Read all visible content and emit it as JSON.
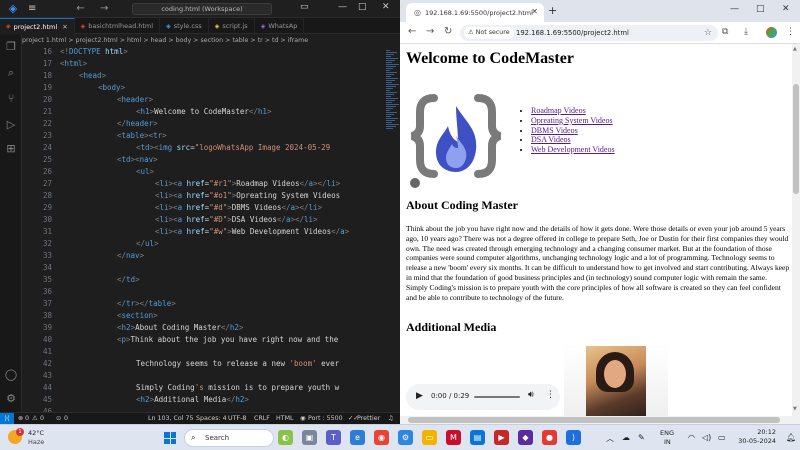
{
  "vscode": {
    "search": "coding.html (Workspace)",
    "tabs": [
      {
        "label": "project2.html",
        "icon": "html-file-icon",
        "active": true
      },
      {
        "label": "basichtmlhead.html",
        "icon": "html-file-icon",
        "active": false
      },
      {
        "label": "style.css",
        "icon": "css-file-icon",
        "active": false
      },
      {
        "label": "script.js",
        "icon": "js-file-icon",
        "active": false
      },
      {
        "label": "WhatsAp",
        "icon": "image-file-icon",
        "active": false
      }
    ],
    "breadcrumb": "project 1.html  >  project2.html  >  html  >  head  >  body  >  section  >  table  >  tr  >  td  >  iframe",
    "lines": [
      {
        "n": "16",
        "indent": 0,
        "parts": [
          [
            "b",
            "<!"
          ],
          [
            "t",
            "DOCTYPE"
          ],
          [
            "a",
            " html"
          ],
          [
            "b",
            ">"
          ]
        ]
      },
      {
        "n": "17",
        "indent": 0,
        "parts": [
          [
            "b",
            "<"
          ],
          [
            "t",
            "html"
          ],
          [
            "b",
            ">"
          ]
        ]
      },
      {
        "n": "18",
        "indent": 1,
        "parts": [
          [
            "b",
            "<"
          ],
          [
            "t",
            "head"
          ],
          [
            "b",
            ">"
          ]
        ]
      },
      {
        "n": "19",
        "indent": 2,
        "parts": [
          [
            "b",
            "<"
          ],
          [
            "t",
            "body"
          ],
          [
            "b",
            ">"
          ]
        ]
      },
      {
        "n": "20",
        "indent": 3,
        "parts": [
          [
            "b",
            "<"
          ],
          [
            "t",
            "header"
          ],
          [
            "b",
            ">"
          ]
        ]
      },
      {
        "n": "21",
        "indent": 4,
        "parts": [
          [
            "b",
            "<"
          ],
          [
            "t",
            "h1"
          ],
          [
            "b",
            ">"
          ],
          [
            "x",
            "Welcome to CodeMaster"
          ],
          [
            "b",
            "</"
          ],
          [
            "t",
            "h1"
          ],
          [
            "b",
            ">"
          ]
        ]
      },
      {
        "n": "22",
        "indent": 3,
        "parts": [
          [
            "b",
            "</"
          ],
          [
            "t",
            "header"
          ],
          [
            "b",
            ">"
          ]
        ]
      },
      {
        "n": "23",
        "indent": 3,
        "parts": [
          [
            "b",
            "<"
          ],
          [
            "t",
            "table"
          ],
          [
            "b",
            "><"
          ],
          [
            "t",
            "tr"
          ],
          [
            "b",
            ">"
          ]
        ]
      },
      {
        "n": "24",
        "indent": 4,
        "parts": [
          [
            "b",
            "<"
          ],
          [
            "t",
            "td"
          ],
          [
            "b",
            "><"
          ],
          [
            "t",
            "img"
          ],
          [
            "a",
            " src"
          ],
          [
            "x",
            "="
          ],
          [
            "s",
            "\"logoWhatsApp Image 2024-05-29"
          ]
        ]
      },
      {
        "n": "25",
        "indent": 3,
        "parts": [
          [
            "b",
            "<"
          ],
          [
            "t",
            "td"
          ],
          [
            "b",
            "><"
          ],
          [
            "t",
            "nav"
          ],
          [
            "b",
            ">"
          ]
        ]
      },
      {
        "n": "26",
        "indent": 4,
        "parts": [
          [
            "b",
            "<"
          ],
          [
            "t",
            "ul"
          ],
          [
            "b",
            ">"
          ]
        ]
      },
      {
        "n": "27",
        "indent": 5,
        "parts": [
          [
            "b",
            "<"
          ],
          [
            "t",
            "li"
          ],
          [
            "b",
            "><"
          ],
          [
            "t",
            "a"
          ],
          [
            "a",
            " href"
          ],
          [
            "x",
            "="
          ],
          [
            "s",
            "\"#r1\""
          ],
          [
            "b",
            ">"
          ],
          [
            "x",
            "Roadmap Videos"
          ],
          [
            "b",
            "</"
          ],
          [
            "t",
            "a"
          ],
          [
            "b",
            "></"
          ],
          [
            "t",
            "li"
          ],
          [
            "b",
            ">"
          ]
        ]
      },
      {
        "n": "28",
        "indent": 5,
        "parts": [
          [
            "b",
            "<"
          ],
          [
            "t",
            "li"
          ],
          [
            "b",
            "><"
          ],
          [
            "t",
            "a"
          ],
          [
            "a",
            " href"
          ],
          [
            "x",
            "="
          ],
          [
            "s",
            "\"#o1\""
          ],
          [
            "b",
            ">"
          ],
          [
            "x",
            "Opreating System Videos"
          ]
        ]
      },
      {
        "n": "29",
        "indent": 5,
        "parts": [
          [
            "b",
            "<"
          ],
          [
            "t",
            "li"
          ],
          [
            "b",
            "><"
          ],
          [
            "t",
            "a"
          ],
          [
            "a",
            " href"
          ],
          [
            "x",
            "="
          ],
          [
            "s",
            "\"#d\""
          ],
          [
            "b",
            ">"
          ],
          [
            "x",
            "DBMS Videos"
          ],
          [
            "b",
            "</"
          ],
          [
            "t",
            "a"
          ],
          [
            "b",
            "></"
          ],
          [
            "t",
            "li"
          ],
          [
            "b",
            ">"
          ]
        ]
      },
      {
        "n": "30",
        "indent": 5,
        "parts": [
          [
            "b",
            "<"
          ],
          [
            "t",
            "li"
          ],
          [
            "b",
            "><"
          ],
          [
            "t",
            "a"
          ],
          [
            "a",
            " href"
          ],
          [
            "x",
            "="
          ],
          [
            "s",
            "\"#D\""
          ],
          [
            "b",
            ">"
          ],
          [
            "x",
            "DSA Videos"
          ],
          [
            "b",
            "</"
          ],
          [
            "t",
            "a"
          ],
          [
            "b",
            "></"
          ],
          [
            "t",
            "li"
          ],
          [
            "b",
            ">"
          ]
        ]
      },
      {
        "n": "31",
        "indent": 5,
        "parts": [
          [
            "b",
            "<"
          ],
          [
            "t",
            "li"
          ],
          [
            "b",
            "><"
          ],
          [
            "t",
            "a"
          ],
          [
            "a",
            " href"
          ],
          [
            "x",
            "="
          ],
          [
            "s",
            "\"#w\""
          ],
          [
            "b",
            ">"
          ],
          [
            "x",
            "Web Development Videos"
          ],
          [
            "b",
            "</"
          ],
          [
            "t",
            "a"
          ],
          [
            "b",
            ">"
          ]
        ]
      },
      {
        "n": "32",
        "indent": 4,
        "parts": [
          [
            "b",
            "</"
          ],
          [
            "t",
            "ul"
          ],
          [
            "b",
            ">"
          ]
        ]
      },
      {
        "n": "33",
        "indent": 3,
        "parts": [
          [
            "b",
            "</"
          ],
          [
            "t",
            "nav"
          ],
          [
            "b",
            ">"
          ]
        ]
      },
      {
        "n": "34",
        "indent": 0,
        "parts": []
      },
      {
        "n": "35",
        "indent": 3,
        "parts": [
          [
            "b",
            "</"
          ],
          [
            "t",
            "td"
          ],
          [
            "b",
            ">"
          ]
        ]
      },
      {
        "n": "36",
        "indent": 0,
        "parts": []
      },
      {
        "n": "37",
        "indent": 3,
        "parts": [
          [
            "b",
            "</"
          ],
          [
            "t",
            "tr"
          ],
          [
            "b",
            "></"
          ],
          [
            "t",
            "table"
          ],
          [
            "b",
            ">"
          ]
        ]
      },
      {
        "n": "38",
        "indent": 3,
        "parts": [
          [
            "b",
            "<"
          ],
          [
            "t",
            "section"
          ],
          [
            "b",
            ">"
          ]
        ]
      },
      {
        "n": "39",
        "indent": 3,
        "parts": [
          [
            "b",
            "<"
          ],
          [
            "t",
            "h2"
          ],
          [
            "b",
            ">"
          ],
          [
            "x",
            "About Coding Master"
          ],
          [
            "b",
            "</"
          ],
          [
            "t",
            "h2"
          ],
          [
            "b",
            ">"
          ]
        ]
      },
      {
        "n": "40",
        "indent": 3,
        "parts": [
          [
            "b",
            "<"
          ],
          [
            "t",
            "p"
          ],
          [
            "b",
            ">"
          ],
          [
            "x",
            "Think about the job you have right now and the"
          ]
        ]
      },
      {
        "n": "41",
        "indent": 0,
        "parts": []
      },
      {
        "n": "42",
        "indent": 4,
        "parts": [
          [
            "x",
            "Technology seems to release a new "
          ],
          [
            "s",
            "'boom'"
          ],
          [
            "x",
            " ever"
          ]
        ]
      },
      {
        "n": "43",
        "indent": 0,
        "parts": []
      },
      {
        "n": "44",
        "indent": 4,
        "parts": [
          [
            "x",
            "Simply Coding"
          ],
          [
            "s",
            "'s"
          ],
          [
            "x",
            " mission is to prepare youth w"
          ]
        ]
      },
      {
        "n": "45",
        "indent": 4,
        "parts": [
          [
            "b",
            "<"
          ],
          [
            "t",
            "h2"
          ],
          [
            "b",
            ">"
          ],
          [
            "x",
            "Additional Media"
          ],
          [
            "b",
            "</"
          ],
          [
            "t",
            "h2"
          ],
          [
            "b",
            ">"
          ]
        ]
      },
      {
        "n": "46",
        "indent": 0,
        "parts": []
      }
    ],
    "status": {
      "errors": "0",
      "warnings": "0",
      "ports": "0",
      "position": "Ln 103, Col 75",
      "spaces": "Spaces: 4",
      "encoding": "UTF-8",
      "eol": "CRLF",
      "language": "HTML",
      "port": "Port : 5500",
      "prettier": "Prettier"
    }
  },
  "chrome": {
    "tab_title": "192.168.1.69:5500/project2.html",
    "not_secure": "Not secure",
    "url": "192.168.1.69:5500/project2.html",
    "page": {
      "h1": "Welcome to CodeMaster",
      "nav": [
        "Roadmap Videos",
        "Opreating System Videos",
        "DBMS Videos",
        "DSA Videos",
        "Web Development Videos"
      ],
      "h2_about": "About Coding Master",
      "paragraph": "Think about the job you have right now and the details of how it gets done. Were those details or even your job around 5 years ago, 10 years ago? There was not a degree offered in college to prepare Seth, Joe or Dustin for their first companies they would own. The need was created through emerging technology and a changing consumer market. But at the foundation of those companies were sound computer algorithms, unchanging technology logic and a lot of programming. Technology seems to release a new 'boom' every six months. It can be difficult to understand how to get involved and start contributing. Always keep in mind that the foundation of good business principles and (in technology) sound computer logic with remain the same. Simply Coding's mission is to prepare youth with the core principles of how all software is created so they can feel confident and be able to contribute to technology of the future.",
      "h2_media": "Additional Media",
      "audio_time": "0:00 / 0:29"
    }
  },
  "taskbar": {
    "temp": "42°C",
    "condition": "Haze",
    "weather_badge": "1",
    "search": "Search",
    "lang1": "ENG",
    "lang2": "IN",
    "time": "20:12",
    "date": "30-05-2024"
  }
}
